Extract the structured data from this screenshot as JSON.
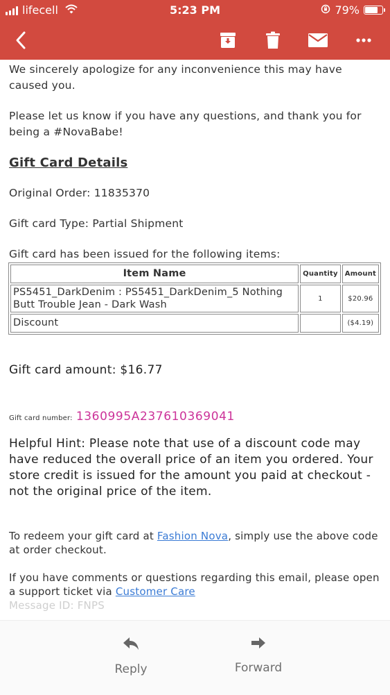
{
  "status_bar": {
    "carrier": "lifecell",
    "time": "5:23 PM",
    "battery": "79%",
    "battery_level": 0.79
  },
  "toolbar": {
    "back_icon": "chevron-left-icon",
    "archive_icon": "archive-icon",
    "trash_icon": "trash-icon",
    "mail_icon": "mail-icon",
    "more_icon": "more-icon"
  },
  "email": {
    "apology": "We sincerely apologize for any inconvenience this may have caused you.",
    "questions": "Please let us know if you have any questions, and thank you for being a #NovaBabe!",
    "details_heading": "Gift Card Details",
    "original_order": "Original Order: 11835370",
    "gift_card_type": "Gift card Type: Partial Shipment",
    "issued_for": "Gift card has been issued for the following items:",
    "table": {
      "headers": [
        "Item Name",
        "Quantity",
        "Amount"
      ],
      "rows": [
        {
          "name": "PS5451_DarkDenim : PS5451_DarkDenim_5 Nothing Butt Trouble Jean - Dark Wash",
          "quantity": "1",
          "amount": "$20.96"
        },
        {
          "name": "Discount",
          "quantity": "",
          "amount": "($4.19)"
        }
      ]
    },
    "gift_card_amount": "Gift card amount: $16.77",
    "gift_card_number_label": "Gift card number:",
    "gift_card_number": "1360995A237610369041",
    "hint": "Helpful Hint: Please note that use of a discount code may have reduced the overall price of an item you ordered. Your store credit is issued for the amount you paid at checkout - not the original price of the item.",
    "redeem_prefix": "To redeem your gift card at ",
    "redeem_link": "Fashion Nova",
    "redeem_suffix": ", simply use the above code at order checkout.",
    "support_prefix": "If you have comments or questions regarding this email, please open a support ticket via ",
    "support_link": "Customer Care",
    "message_id": "Message ID: FNPS"
  },
  "actions": {
    "reply": "Reply",
    "forward": "Forward"
  }
}
